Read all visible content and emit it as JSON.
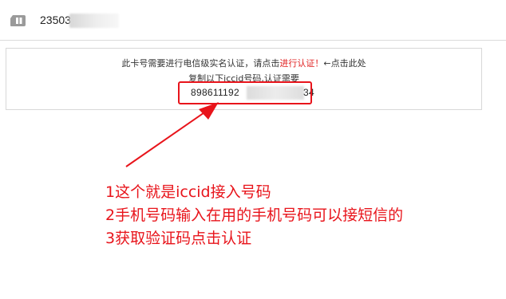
{
  "header": {
    "sim_icon": "sim-card-icon",
    "sim_number_visible": "23503"
  },
  "notice": {
    "line1_prefix": "此卡号需要进行电信级实名认证，请点击",
    "line1_link": "进行认证！",
    "line1_suffix": "←点击此处",
    "line2": "复制以下iccid号码,认证需要",
    "iccid_prefix": "898611192",
    "iccid_suffix": "34"
  },
  "annotations": {
    "line1": "1这个就是iccid接入号码",
    "line2": "2手机号码输入在用的手机号码可以接短信的",
    "line3": "3获取验证码点击认证"
  },
  "colors": {
    "accent_red": "#e8141b",
    "link_red": "#e02020",
    "border_gray": "#d8d8d8"
  }
}
